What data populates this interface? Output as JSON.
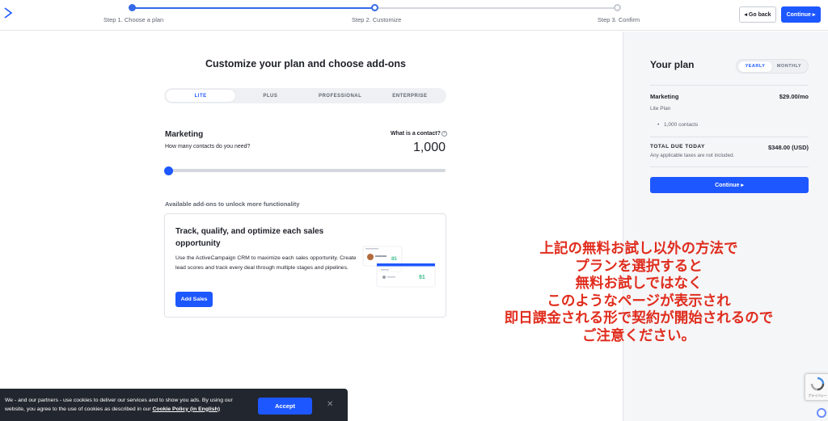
{
  "header": {
    "steps": [
      {
        "label": "Step 1. Choose a plan",
        "state": "done"
      },
      {
        "label": "Step 2. Customize",
        "state": "current"
      },
      {
        "label": "Step 3. Confirm",
        "state": "todo"
      }
    ],
    "back_label": "◂ Go back",
    "continue_label": "Continue ▸"
  },
  "main": {
    "title": "Customize your plan and choose add-ons",
    "tiers": [
      "LITE",
      "PLUS",
      "PROFESSIONAL",
      "ENTERPRISE"
    ],
    "active_tier": "LITE",
    "marketing_title": "Marketing",
    "marketing_subtitle": "How many contacts do you need?",
    "what_is_contact": "What is a contact?",
    "contact_count": "1,000",
    "slider_value_fraction": 0.0,
    "addons_heading": "Available add-ons to unlock more functionality",
    "addon": {
      "title": "Track, qualify, and optimize each sales opportunity",
      "description": "Use the ActiveCampaign CRM to maximize each sales opportunity. Create lead scores and track every deal through multiple stages and pipelines.",
      "button_label": "Add Sales",
      "illustration_scores": [
        "85",
        "91"
      ]
    }
  },
  "plan_panel": {
    "title": "Your plan",
    "billing_options": [
      "YEARLY",
      "MONTHLY"
    ],
    "active_billing": "YEARLY",
    "product": "Marketing",
    "price": "$29.00/mo",
    "plan_name": "Lite Plan",
    "contacts_line": "1,000 contacts",
    "total_label": "TOTAL DUE TODAY",
    "total_amount": "$348.00 (USD)",
    "tax_note": "Any applicable taxes are not included.",
    "continue_label": "Continue ▸"
  },
  "annotation": {
    "lines": [
      "上記の無料お試し以外の方法で",
      "プランを選択すると",
      "無料お試しではなく",
      "このようなページが表示され",
      "即日課金される形で契約が開始されるので",
      "ご注意ください。"
    ],
    "color": "#e02d1e"
  },
  "cookie_banner": {
    "text_before": "We - and our partners - use cookies to deliver our services and to show you ads. By using our website, you agree to the use of cookies as described in our ",
    "link_text": "Cookie Policy (in English)",
    "accept_label": "Accept",
    "close_symbol": "✕"
  },
  "recaptcha_text": "プライバシー",
  "colors": {
    "brand_blue": "#1d57ff",
    "progress_blue": "#356ae6",
    "panel_bg": "#f5f6f8",
    "cookie_bg": "#22262e"
  }
}
